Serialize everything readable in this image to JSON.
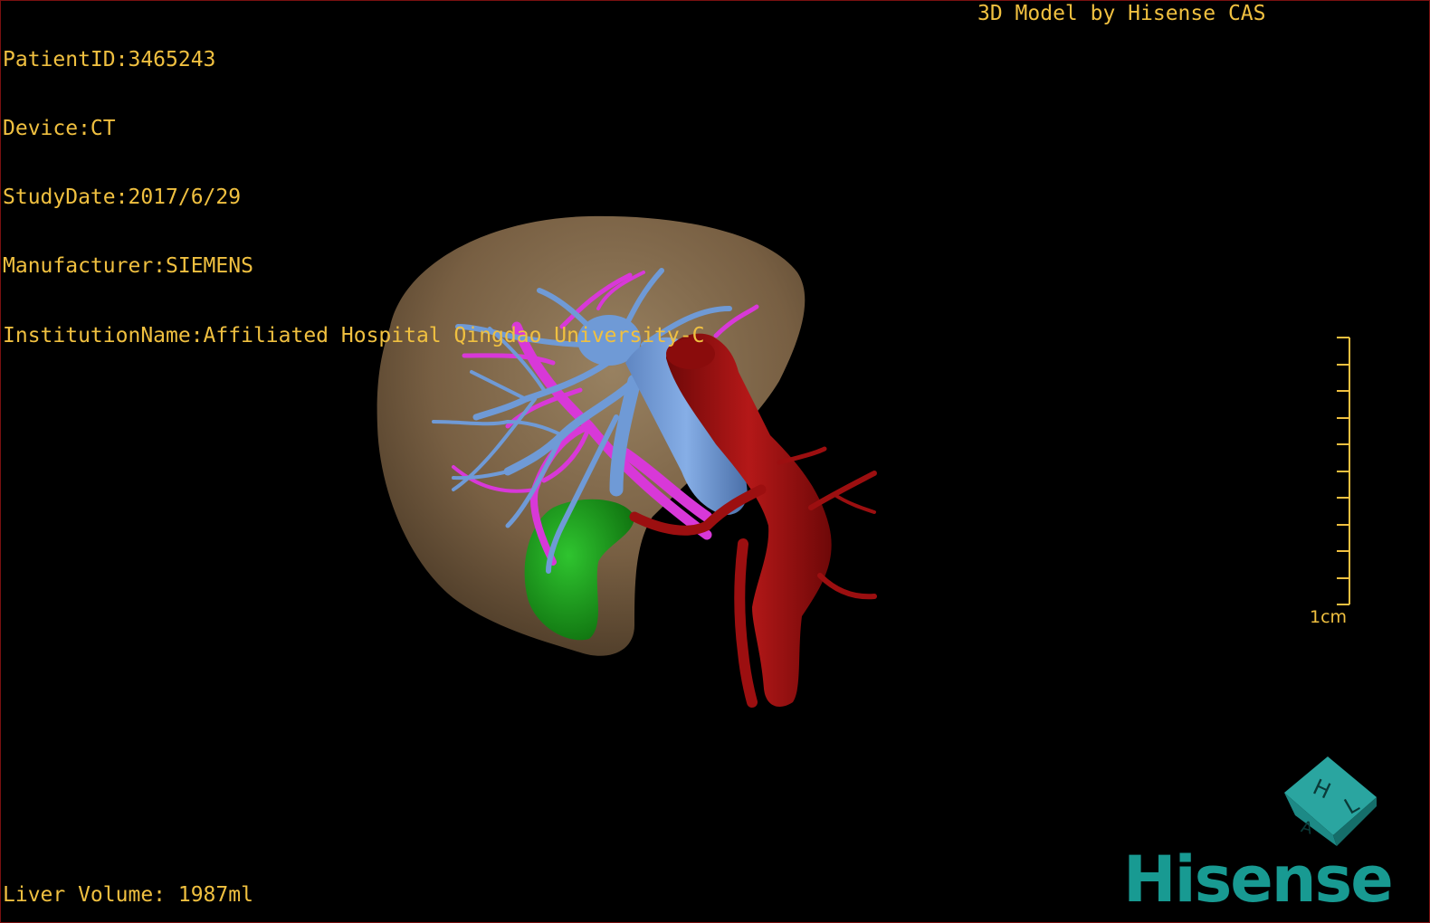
{
  "header": {
    "patient_id": "PatientID:3465243",
    "device": "Device:CT",
    "study_date": "StudyDate:2017/6/29",
    "manufacturer": "Manufacturer:SIEMENS",
    "institution": "InstitutionName:Affiliated Hospital Qingdao University-C"
  },
  "credit": "3D Model by Hisense CAS",
  "footer": {
    "liver_volume": "Liver Volume: 1987ml"
  },
  "scale_bar": {
    "label": "1cm"
  },
  "orientation_cube": {
    "faces": [
      "H",
      "L",
      "A"
    ]
  },
  "logo": {
    "text": "Hisense"
  },
  "colors": {
    "overlay_text": "#f0c040",
    "liver": "#8a6d4c",
    "portal_vein": "#6f9ad6",
    "hepatic_vessels": "#d838d8",
    "artery": "#9c0f10",
    "gallbladder": "#1c9e1c",
    "brand": "#189a92"
  }
}
